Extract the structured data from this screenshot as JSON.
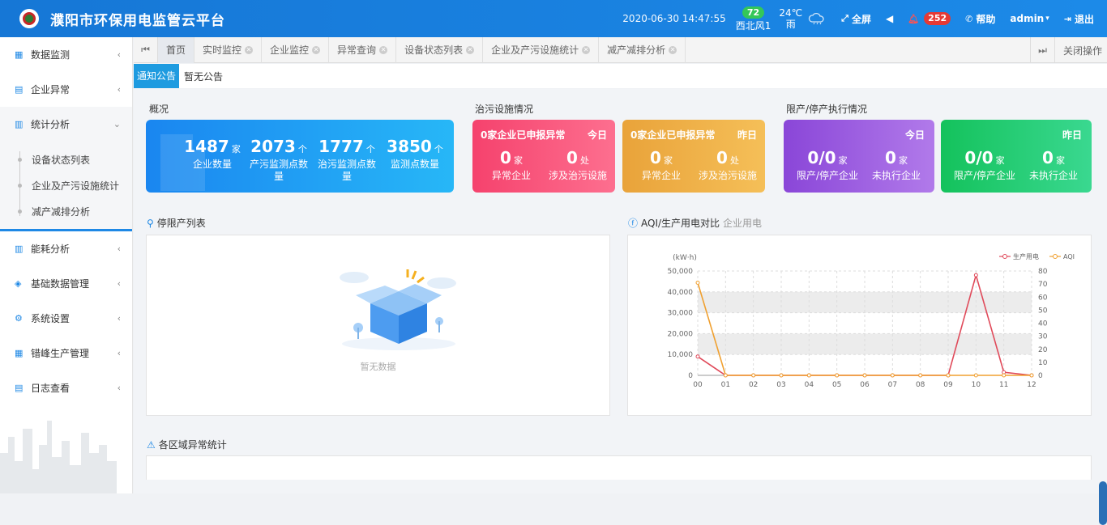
{
  "header": {
    "title": "濮阳市环保用电监管云平台",
    "datetime": "2020-06-30  14:47:55",
    "aqi": "72",
    "temperature": "24℃",
    "wind": "西北风1",
    "weather": "雨",
    "fullscreen": "全屏",
    "alerts": "252",
    "help": "帮助",
    "user": "admin",
    "logout": "退出"
  },
  "sidebar": {
    "items": [
      {
        "label": "数据监测"
      },
      {
        "label": "企业异常"
      },
      {
        "label": "统计分析"
      },
      {
        "label": "能耗分析"
      },
      {
        "label": "基础数据管理"
      },
      {
        "label": "系统设置"
      },
      {
        "label": "错峰生产管理"
      },
      {
        "label": "日志查看"
      }
    ],
    "sub": [
      "设备状态列表",
      "企业及产污设施统计",
      "减产减排分析"
    ]
  },
  "tabs": {
    "items": [
      "首页",
      "实时监控",
      "企业监控",
      "异常查询",
      "设备状态列表",
      "企业及产污设施统计",
      "减产减排分析"
    ],
    "close_ops": "关闭操作"
  },
  "notice": {
    "button": "通知公告",
    "text": "暂无公告"
  },
  "overview": {
    "title": "概况",
    "stats": [
      {
        "value": "1487",
        "unit": "家",
        "label": "企业数量"
      },
      {
        "value": "2073",
        "unit": "个",
        "label": "产污监测点数量"
      },
      {
        "value": "1777",
        "unit": "个",
        "label": "治污监测点数量"
      },
      {
        "value": "3850",
        "unit": "个",
        "label": "监测点数量"
      }
    ]
  },
  "facility": {
    "title": "治污设施情况",
    "cards": [
      {
        "head": "0家企业已申报异常",
        "tag": "今日",
        "a_val": "0",
        "a_unit": "家",
        "a_lbl": "异常企业",
        "b_val": "0",
        "b_unit": "处",
        "b_lbl": "涉及治污设施"
      },
      {
        "head": "0家企业已申报异常",
        "tag": "昨日",
        "a_val": "0",
        "a_unit": "家",
        "a_lbl": "异常企业",
        "b_val": "0",
        "b_unit": "处",
        "b_lbl": "涉及治污设施"
      }
    ]
  },
  "limit": {
    "title": "限产/停产执行情况",
    "cards": [
      {
        "tag": "今日",
        "a_val": "0/0",
        "a_unit": "家",
        "a_lbl": "限产/停产企业",
        "b_val": "0",
        "b_unit": "家",
        "b_lbl": "未执行企业"
      },
      {
        "tag": "昨日",
        "a_val": "0/0",
        "a_unit": "家",
        "a_lbl": "限产/停产企业",
        "b_val": "0",
        "b_unit": "家",
        "b_lbl": "未执行企业"
      }
    ]
  },
  "stoplist": {
    "title": "停限产列表",
    "empty": "暂无数据"
  },
  "aqi_panel": {
    "title": "AQI/生产用电对比",
    "sub": "企业用电"
  },
  "region": {
    "title": "各区域异常统计"
  },
  "colors": {
    "primary": "#1e88e5",
    "power": "#e04a5a",
    "aqi": "#f0a030"
  },
  "chart_data": {
    "type": "line",
    "x": [
      "00",
      "01",
      "02",
      "03",
      "04",
      "05",
      "06",
      "07",
      "08",
      "09",
      "10",
      "11",
      "12"
    ],
    "ylabel": "(kW·h)",
    "ylim": [
      0,
      50000
    ],
    "y2lim": [
      0,
      80
    ],
    "yticks": [
      "0",
      "10,000",
      "20,000",
      "30,000",
      "40,000",
      "50,000"
    ],
    "y2ticks": [
      "0",
      "10",
      "20",
      "30",
      "40",
      "50",
      "60",
      "70",
      "80"
    ],
    "series": [
      {
        "name": "生产用电",
        "axis": "left",
        "color": "#e04a5a",
        "values": [
          9000,
          0,
          0,
          0,
          0,
          0,
          0,
          0,
          0,
          0,
          48000,
          1500,
          0
        ]
      },
      {
        "name": "AQI",
        "axis": "right",
        "color": "#f0a030",
        "values": [
          71,
          0,
          0,
          0,
          0,
          0,
          0,
          0,
          0,
          0,
          0,
          0,
          0
        ]
      }
    ],
    "grid": true,
    "legend": "top-right"
  }
}
